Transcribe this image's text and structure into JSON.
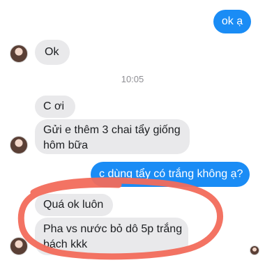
{
  "messages": {
    "out_1": "ok ạ",
    "in_1": "Ok",
    "timestamp": "10:05",
    "in_2": "C ơi",
    "in_3_line1": "Gửi e thêm 3 chai tẩy giống",
    "in_3_line2": "hôm bữa",
    "out_2": "c dùng tẩy có trắng không ạ?",
    "in_4": "Quá ok luôn",
    "in_5_line1": "Pha vs nước bỏ dô 5p trắng",
    "in_5_line2": "bách kkk"
  },
  "colors": {
    "outgoing_bubble": "#1a8cf5",
    "incoming_bubble": "#e9e9eb",
    "highlight_circle": "#f26b5b"
  },
  "icons": {
    "contact_avatar": "avatar",
    "seen_indicator": "seen-avatar-icon"
  }
}
